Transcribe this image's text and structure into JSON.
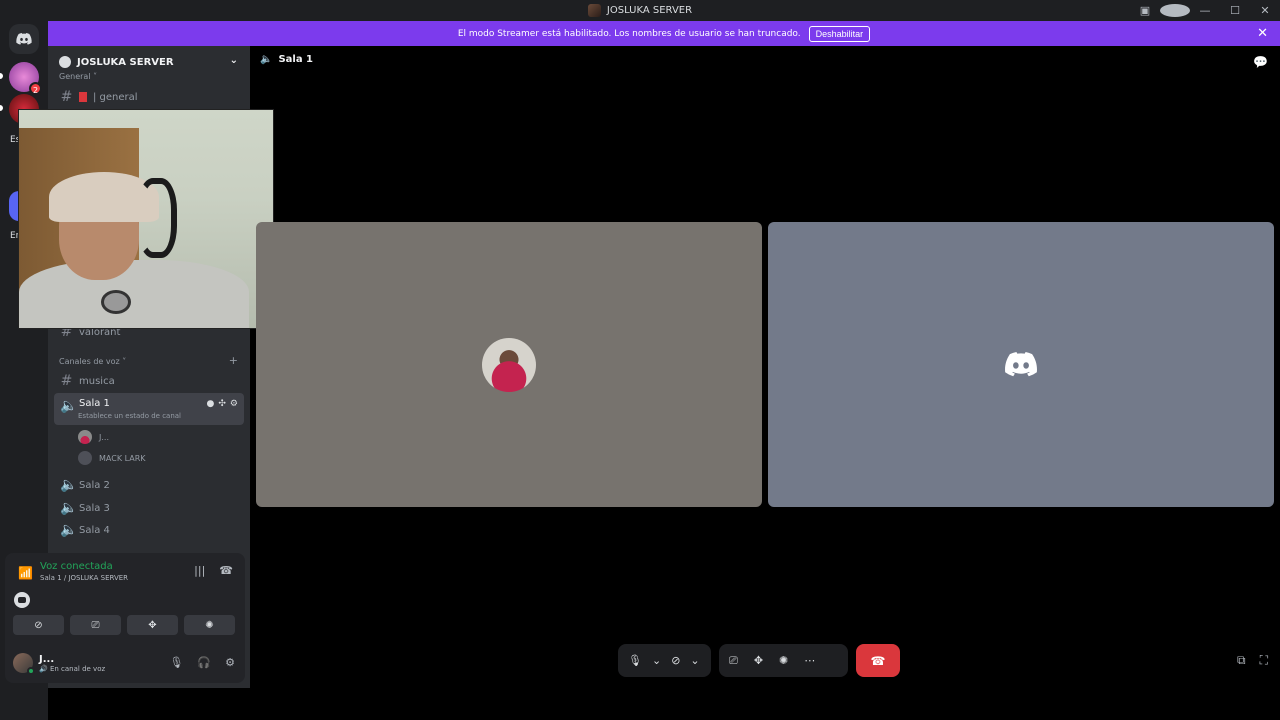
{
  "window": {
    "title": "JOSLUKA SERVER",
    "min": "—",
    "max": "☐",
    "close": "✕"
  },
  "banner": {
    "text": "El modo Streamer está habilitado. Los nombres de usuario se han truncado.",
    "button": "Deshabilitar"
  },
  "server_rail": {
    "badge": "2",
    "letters": [
      "Es",
      "Er"
    ]
  },
  "sidebar": {
    "server_name": "JOSLUKA SERVER",
    "category_general": "General",
    "channel_general": "| general",
    "channel_valorant": "valorant",
    "category_voice": "Canales de voz",
    "channel_musica": "musica",
    "active_channel": "Sala 1",
    "active_channel_sub": "Establece un estado de canal",
    "members": [
      "J...",
      "MACK LARK"
    ],
    "voice_channels": [
      "Sala 2",
      "Sala 3",
      "Sala 4"
    ]
  },
  "user_panel": {
    "voice_status": "Voz conectada",
    "voice_location": "Sala 1 / JOSLUKA SERVER",
    "username": "J...",
    "status": "En canal de voz"
  },
  "call": {
    "channel_name": "Sala 1"
  },
  "colors": {
    "banner": "#7c3bed",
    "connected_green": "#23a55a",
    "leave_red": "#da373c",
    "tile_1": "#77736e",
    "tile_2": "#737a8a"
  }
}
